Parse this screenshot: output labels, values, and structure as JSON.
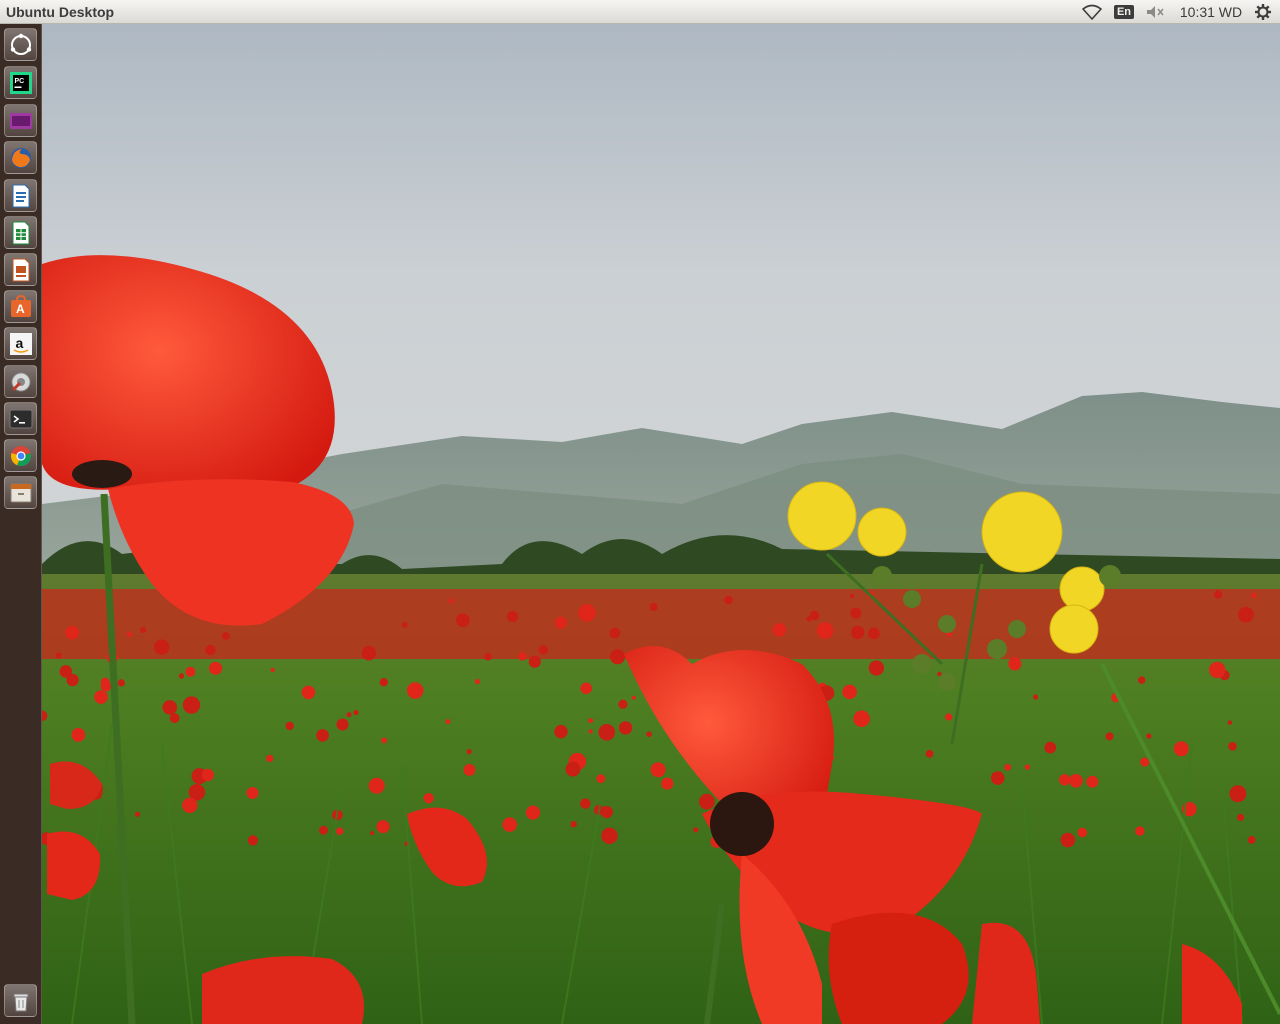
{
  "panel": {
    "title": "Ubuntu Desktop",
    "keyboard_layout": "En",
    "clock": "10:31 WD",
    "indicators": [
      "wifi-icon",
      "keyboard-layout",
      "volume-muted-icon",
      "clock",
      "session-gear-icon"
    ]
  },
  "launcher": {
    "items": [
      "ubuntu-dash-icon",
      "pycharm-icon",
      "video-player-icon",
      "firefox-icon",
      "libreoffice-writer-icon",
      "libreoffice-calc-icon",
      "libreoffice-impress-icon",
      "ubuntu-software-center-icon",
      "amazon-icon",
      "system-settings-icon",
      "terminal-icon",
      "chrome-icon",
      "file-manager-icon",
      "trash-icon"
    ]
  },
  "desktop": {
    "wallpaper": "poppy-field-with-mountains"
  },
  "colors": {
    "panel": "#dcdad5",
    "launcher": "#6b4a3e",
    "sky": "#c9ced2",
    "poppy": "#e8271c"
  }
}
